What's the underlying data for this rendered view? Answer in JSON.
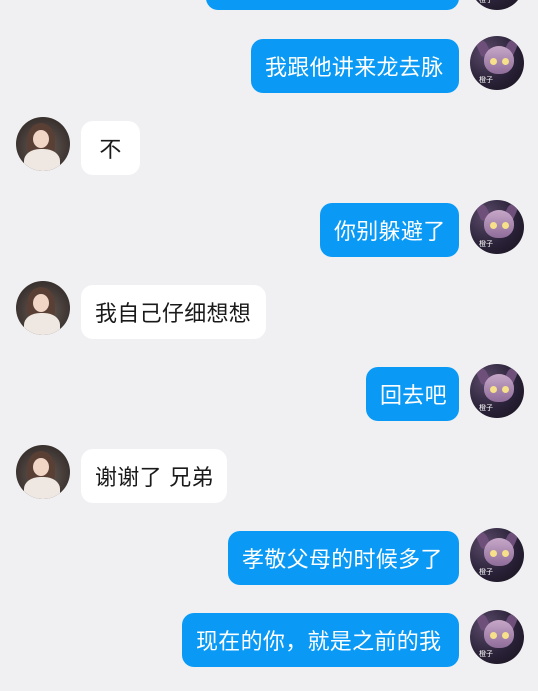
{
  "colors": {
    "background": "#f0f0f2",
    "outgoing_bubble": "#0a9af5",
    "incoming_bubble": "#ffffff",
    "outgoing_text": "#ffffff",
    "incoming_text": "#1a1a1a"
  },
  "my_avatar": {
    "icon": "avatar-game-character",
    "tag_text": "橙子"
  },
  "their_avatar": {
    "icon": "avatar-girl-photo"
  },
  "messages": [
    {
      "sender": "me",
      "text": ""
    },
    {
      "sender": "me",
      "text": "我跟他讲来龙去脉"
    },
    {
      "sender": "them",
      "text": "不"
    },
    {
      "sender": "me",
      "text": "你别躲避了"
    },
    {
      "sender": "them",
      "text": "我自己仔细想想"
    },
    {
      "sender": "me",
      "text": "回去吧"
    },
    {
      "sender": "them",
      "text": "谢谢了 兄弟"
    },
    {
      "sender": "me",
      "text": "孝敬父母的时候多了"
    },
    {
      "sender": "me",
      "text": "现在的你，就是之前的我"
    }
  ]
}
